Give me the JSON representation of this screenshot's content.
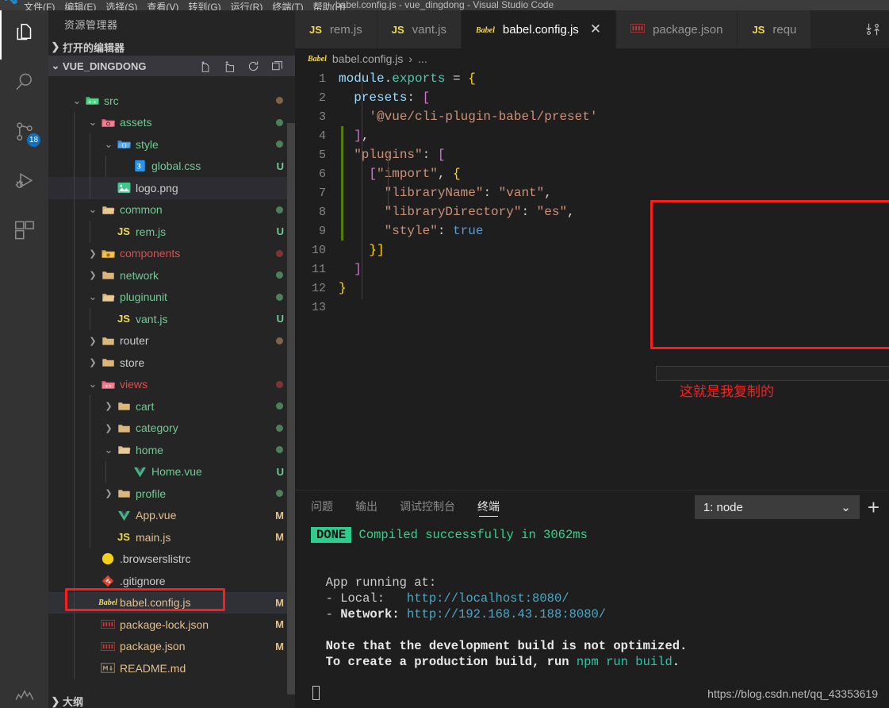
{
  "titlebar": {
    "window_title": "babel.config.js - vue_dingdong - Visual Studio Code",
    "menus": [
      "文件(F)",
      "编辑(E)",
      "选择(S)",
      "查看(V)",
      "转到(G)",
      "运行(R)",
      "终端(T)",
      "帮助(H)"
    ]
  },
  "activitybar": {
    "items": [
      {
        "name": "explorer",
        "icon": "files-icon"
      },
      {
        "name": "search",
        "icon": "search-icon"
      },
      {
        "name": "source-control",
        "icon": "source-control-icon",
        "badge": "18"
      },
      {
        "name": "run-debug",
        "icon": "run-debug-icon"
      },
      {
        "name": "extensions",
        "icon": "extensions-icon"
      }
    ],
    "manage_icon": "gear-icon"
  },
  "sidebar": {
    "title": "资源管理器",
    "open_editors_label": "打开的编辑器",
    "project_label": "VUE_DINGDONG",
    "outline_label": "大纲",
    "actions": [
      "new-file-icon",
      "new-folder-icon",
      "refresh-icon",
      "collapse-all-icon"
    ],
    "tree": [
      {
        "depth": 1,
        "twisty": "down",
        "icon": "folder-src",
        "name": "src",
        "color": "green",
        "status": "",
        "dot": "tan"
      },
      {
        "depth": 2,
        "twisty": "down",
        "icon": "folder-assets",
        "name": "assets",
        "color": "green",
        "status": "",
        "dot": "green"
      },
      {
        "depth": 3,
        "twisty": "down",
        "icon": "folder-style",
        "name": "style",
        "color": "green",
        "status": "",
        "dot": "green"
      },
      {
        "depth": 4,
        "twisty": "none",
        "icon": "css-icon",
        "name": "global.css",
        "color": "green",
        "status": "U",
        "dot": ""
      },
      {
        "depth": 3,
        "twisty": "none",
        "icon": "image-icon",
        "name": "logo.png",
        "color": "white",
        "status": "",
        "dot": "",
        "highlight": true
      },
      {
        "depth": 2,
        "twisty": "down",
        "icon": "folder-open",
        "name": "common",
        "color": "green",
        "status": "",
        "dot": "green"
      },
      {
        "depth": 3,
        "twisty": "none",
        "icon": "js-icon",
        "name": "rem.js",
        "color": "green",
        "status": "U",
        "dot": ""
      },
      {
        "depth": 2,
        "twisty": "right",
        "icon": "folder-components",
        "name": "components",
        "color": "red",
        "status": "",
        "dot": "red"
      },
      {
        "depth": 2,
        "twisty": "right",
        "icon": "folder",
        "name": "network",
        "color": "green",
        "status": "",
        "dot": "green"
      },
      {
        "depth": 2,
        "twisty": "down",
        "icon": "folder-open",
        "name": "pluginunit",
        "color": "green",
        "status": "",
        "dot": "green"
      },
      {
        "depth": 3,
        "twisty": "none",
        "icon": "js-icon",
        "name": "vant.js",
        "color": "green",
        "status": "U",
        "dot": ""
      },
      {
        "depth": 2,
        "twisty": "right",
        "icon": "folder",
        "name": "router",
        "color": "white",
        "status": "",
        "dot": "tan"
      },
      {
        "depth": 2,
        "twisty": "right",
        "icon": "folder",
        "name": "store",
        "color": "white",
        "status": "",
        "dot": ""
      },
      {
        "depth": 2,
        "twisty": "down",
        "icon": "folder-views",
        "name": "views",
        "color": "red",
        "status": "",
        "dot": "red"
      },
      {
        "depth": 3,
        "twisty": "right",
        "icon": "folder",
        "name": "cart",
        "color": "green",
        "status": "",
        "dot": "green"
      },
      {
        "depth": 3,
        "twisty": "right",
        "icon": "folder",
        "name": "category",
        "color": "green",
        "status": "",
        "dot": "green"
      },
      {
        "depth": 3,
        "twisty": "down",
        "icon": "folder-open",
        "name": "home",
        "color": "green",
        "status": "",
        "dot": "green"
      },
      {
        "depth": 4,
        "twisty": "none",
        "icon": "vue-icon",
        "name": "Home.vue",
        "color": "green",
        "status": "U",
        "dot": ""
      },
      {
        "depth": 3,
        "twisty": "right",
        "icon": "folder",
        "name": "profile",
        "color": "green",
        "status": "",
        "dot": "green"
      },
      {
        "depth": 3,
        "twisty": "none",
        "icon": "vue-icon",
        "name": "App.vue",
        "color": "yellow",
        "status": "M",
        "dot": ""
      },
      {
        "depth": 3,
        "twisty": "none",
        "icon": "js-icon",
        "name": "main.js",
        "color": "yellow",
        "status": "M",
        "dot": ""
      },
      {
        "depth": 2,
        "twisty": "none",
        "icon": "browserslist-icon",
        "name": ".browserslistrc",
        "color": "white",
        "status": "",
        "dot": ""
      },
      {
        "depth": 2,
        "twisty": "none",
        "icon": "git-icon",
        "name": ".gitignore",
        "color": "white",
        "status": "",
        "dot": ""
      },
      {
        "depth": 2,
        "twisty": "none",
        "icon": "babel-icon",
        "name": "babel.config.js",
        "color": "yellow",
        "status": "M",
        "dot": "",
        "selected": true,
        "boxed": true
      },
      {
        "depth": 2,
        "twisty": "none",
        "icon": "npm-icon",
        "name": "package-lock.json",
        "color": "yellow",
        "status": "M",
        "dot": ""
      },
      {
        "depth": 2,
        "twisty": "none",
        "icon": "npm-icon",
        "name": "package.json",
        "color": "yellow",
        "status": "M",
        "dot": ""
      },
      {
        "depth": 2,
        "twisty": "none",
        "icon": "markdown-icon",
        "name": "README.md",
        "color": "yellow",
        "status": "",
        "dot": ""
      }
    ]
  },
  "editor": {
    "tabs": [
      {
        "icon": "js-icon",
        "label": "rem.js",
        "active": false,
        "closable": false
      },
      {
        "icon": "js-icon",
        "label": "vant.js",
        "active": false,
        "closable": false
      },
      {
        "icon": "babel-icon",
        "label": "babel.config.js",
        "active": true,
        "closable": true,
        "close_glyph": "✕"
      },
      {
        "icon": "npm-icon",
        "label": "package.json",
        "active": false,
        "closable": false
      },
      {
        "icon": "js-icon",
        "label": "requ",
        "active": false,
        "closable": false
      }
    ],
    "tabs_action_icon": "split-editor-icon",
    "breadcrumb": {
      "icon": "babel-icon",
      "file": "babel.config.js",
      "separator": "›",
      "rest": "..."
    },
    "lines": [
      {
        "n": "1",
        "tokens": [
          {
            "t": "module",
            "c": "t-key"
          },
          {
            "t": ".",
            "c": "t-op"
          },
          {
            "t": "exports",
            "c": "t-fn"
          },
          {
            "t": " = ",
            "c": "t-op"
          },
          {
            "t": "{",
            "c": "t-brace"
          }
        ],
        "indent": ""
      },
      {
        "n": "2",
        "tokens": [
          {
            "t": "  ",
            "c": "t-op"
          },
          {
            "t": "presets",
            "c": "t-prop"
          },
          {
            "t": ": ",
            "c": "t-op"
          },
          {
            "t": "[",
            "c": "t-brack"
          }
        ],
        "indent": ""
      },
      {
        "n": "3",
        "tokens": [
          {
            "t": "    ",
            "c": "t-op"
          },
          {
            "t": "'@vue/cli-plugin-babel/preset'",
            "c": "t-str"
          }
        ],
        "indent": ""
      },
      {
        "n": "4",
        "tokens": [
          {
            "t": "  ",
            "c": "t-op"
          },
          {
            "t": "]",
            "c": "t-brack"
          },
          {
            "t": ",",
            "c": "t-op"
          }
        ],
        "indent": ""
      },
      {
        "n": "5",
        "tokens": [
          {
            "t": "  ",
            "c": "t-op"
          },
          {
            "t": "\"plugins\"",
            "c": "t-str"
          },
          {
            "t": ": ",
            "c": "t-op"
          },
          {
            "t": "[",
            "c": "t-brack"
          }
        ],
        "indent": ""
      },
      {
        "n": "6",
        "tokens": [
          {
            "t": "    ",
            "c": "t-op"
          },
          {
            "t": "[",
            "c": "t-brack"
          },
          {
            "t": "\"import\"",
            "c": "t-str"
          },
          {
            "t": ", ",
            "c": "t-op"
          },
          {
            "t": "{",
            "c": "t-brace"
          }
        ],
        "indent": ""
      },
      {
        "n": "7",
        "tokens": [
          {
            "t": "      ",
            "c": "t-op"
          },
          {
            "t": "\"libraryName\"",
            "c": "t-str"
          },
          {
            "t": ": ",
            "c": "t-op"
          },
          {
            "t": "\"vant\"",
            "c": "t-str"
          },
          {
            "t": ",",
            "c": "t-op"
          }
        ],
        "indent": ""
      },
      {
        "n": "8",
        "tokens": [
          {
            "t": "      ",
            "c": "t-op"
          },
          {
            "t": "\"libraryDirectory\"",
            "c": "t-str"
          },
          {
            "t": ": ",
            "c": "t-op"
          },
          {
            "t": "\"es\"",
            "c": "t-str"
          },
          {
            "t": ",",
            "c": "t-op"
          }
        ],
        "indent": ""
      },
      {
        "n": "9",
        "tokens": [
          {
            "t": "      ",
            "c": "t-op"
          },
          {
            "t": "\"style\"",
            "c": "t-str"
          },
          {
            "t": ": ",
            "c": "t-op"
          },
          {
            "t": "true",
            "c": "t-bool"
          }
        ],
        "indent": ""
      },
      {
        "n": "10",
        "tokens": [
          {
            "t": "    ",
            "c": "t-op"
          },
          {
            "t": "}]",
            "c": "t-brace"
          }
        ],
        "indent": ""
      },
      {
        "n": "11",
        "tokens": [
          {
            "t": "  ",
            "c": "t-op"
          },
          {
            "t": "]",
            "c": "t-brack"
          }
        ],
        "indent": ""
      },
      {
        "n": "12",
        "tokens": [
          {
            "t": "}",
            "c": "t-brace"
          }
        ],
        "indent": ""
      },
      {
        "n": "13",
        "tokens": [],
        "indent": ""
      }
    ],
    "annotation": "这就是我复制的"
  },
  "panel": {
    "tabs": [
      "问题",
      "输出",
      "调试控制台",
      "终端"
    ],
    "active_tab": "终端",
    "terminal_select": "1: node",
    "terminal_select_chevron": "⌄",
    "add_terminal_icon": "plus-icon",
    "terminal_lines": [
      {
        "type": "badge",
        "badge": "DONE",
        "text": " Compiled successfully in 3062ms",
        "cls": "t-ok"
      },
      {
        "type": "blank"
      },
      {
        "type": "blank"
      },
      {
        "type": "plain",
        "text": "  App running at:"
      },
      {
        "type": "mixed",
        "parts": [
          {
            "t": "  - Local:   ",
            "c": ""
          },
          {
            "t": "http://localhost:8080/",
            "c": "t-link"
          }
        ]
      },
      {
        "type": "mixed",
        "parts": [
          {
            "t": "  - ",
            "c": ""
          },
          {
            "t": "Network:",
            "c": "t-bold"
          },
          {
            "t": " ",
            "c": ""
          },
          {
            "t": "http://192.168.43.188:8080/",
            "c": "t-link"
          }
        ]
      },
      {
        "type": "blank"
      },
      {
        "type": "mixed",
        "parts": [
          {
            "t": "  Note that the development build is not optimized.",
            "c": "t-bold"
          }
        ]
      },
      {
        "type": "mixed",
        "parts": [
          {
            "t": "  To create a production build, run ",
            "c": "t-bold"
          },
          {
            "t": "npm run build",
            "c": "t-cmd"
          },
          {
            "t": ".",
            "c": "t-bold"
          }
        ]
      },
      {
        "type": "blank"
      },
      {
        "type": "cursor"
      }
    ]
  },
  "watermark": "https://blog.csdn.net/qq_43353619"
}
